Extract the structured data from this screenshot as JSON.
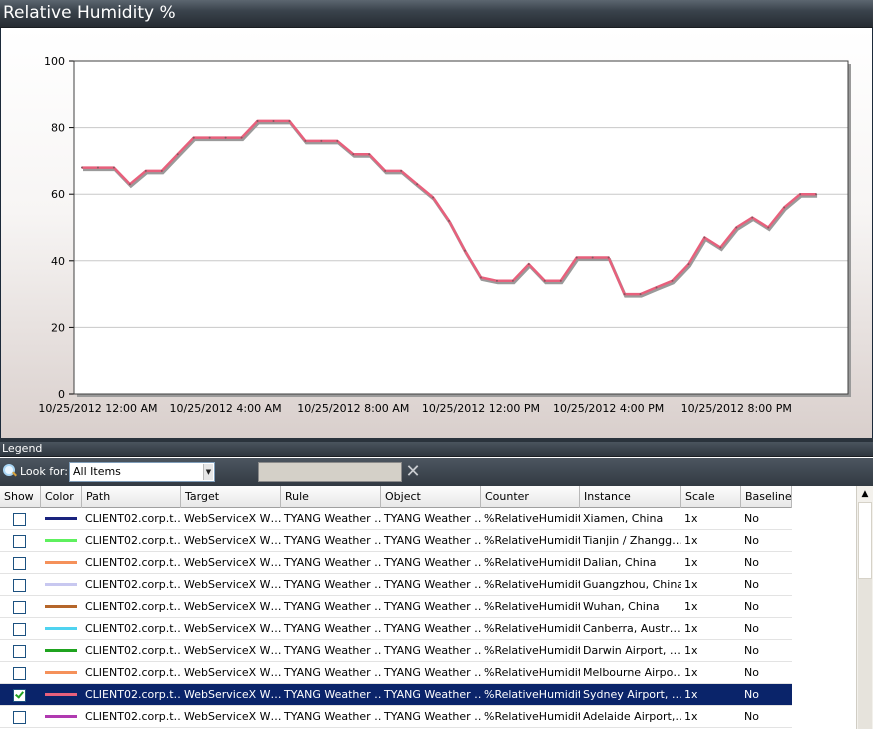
{
  "window": {
    "title": "Relative Humidity %"
  },
  "legend": {
    "title": "Legend",
    "look_for_label": "Look for:",
    "look_for_value": "All Items",
    "columns": [
      "Show",
      "Color",
      "Path",
      "Target",
      "Rule",
      "Object",
      "Counter",
      "Instance",
      "Scale",
      "Baseline"
    ],
    "rows": [
      {
        "show": false,
        "color": "#1a237e",
        "path": "CLIENT02.corp.t…",
        "target": "WebServiceX W…",
        "rule": "TYANG Weather …",
        "object": "TYANG Weather …",
        "counter": "%RelativeHumidity",
        "instance": "Xiamen, China",
        "scale": "1x",
        "baseline": "No"
      },
      {
        "show": false,
        "color": "#5ef05e",
        "path": "CLIENT02.corp.t…",
        "target": "WebServiceX W…",
        "rule": "TYANG Weather …",
        "object": "TYANG Weather …",
        "counter": "%RelativeHumidity",
        "instance": "Tianjin / Zhangg…",
        "scale": "1x",
        "baseline": "No"
      },
      {
        "show": false,
        "color": "#f5915a",
        "path": "CLIENT02.corp.t…",
        "target": "WebServiceX W…",
        "rule": "TYANG Weather …",
        "object": "TYANG Weather …",
        "counter": "%RelativeHumidity",
        "instance": "Dalian, China",
        "scale": "1x",
        "baseline": "No"
      },
      {
        "show": false,
        "color": "#c8c8f0",
        "path": "CLIENT02.corp.t…",
        "target": "WebServiceX W…",
        "rule": "TYANG Weather …",
        "object": "TYANG Weather …",
        "counter": "%RelativeHumidity",
        "instance": "Guangzhou, China",
        "scale": "1x",
        "baseline": "No"
      },
      {
        "show": false,
        "color": "#b5662a",
        "path": "CLIENT02.corp.t…",
        "target": "WebServiceX W…",
        "rule": "TYANG Weather …",
        "object": "TYANG Weather …",
        "counter": "%RelativeHumidity",
        "instance": "Wuhan, China",
        "scale": "1x",
        "baseline": "No"
      },
      {
        "show": false,
        "color": "#4fd3f0",
        "path": "CLIENT02.corp.t…",
        "target": "WebServiceX W…",
        "rule": "TYANG Weather …",
        "object": "TYANG Weather …",
        "counter": "%RelativeHumidity",
        "instance": "Canberra, Austr…",
        "scale": "1x",
        "baseline": "No"
      },
      {
        "show": false,
        "color": "#1fa31f",
        "path": "CLIENT02.corp.t…",
        "target": "WebServiceX W…",
        "rule": "TYANG Weather …",
        "object": "TYANG Weather …",
        "counter": "%RelativeHumidity",
        "instance": "Darwin Airport, …",
        "scale": "1x",
        "baseline": "No"
      },
      {
        "show": false,
        "color": "#f5915a",
        "path": "CLIENT02.corp.t…",
        "target": "WebServiceX W…",
        "rule": "TYANG Weather …",
        "object": "TYANG Weather …",
        "counter": "%RelativeHumidity",
        "instance": "Melbourne Airpo…",
        "scale": "1x",
        "baseline": "No"
      },
      {
        "show": true,
        "selected": true,
        "color": "#e8607c",
        "path": "CLIENT02.corp.t…",
        "target": "WebServiceX W…",
        "rule": "TYANG Weather …",
        "object": "TYANG Weather …",
        "counter": "%RelativeHumidity",
        "instance": "Sydney Airport, …",
        "scale": "1x",
        "baseline": "No"
      },
      {
        "show": false,
        "color": "#b03ab0",
        "path": "CLIENT02.corp.t…",
        "target": "WebServiceX W…",
        "rule": "TYANG Weather …",
        "object": "TYANG Weather …",
        "counter": "%RelativeHumidity",
        "instance": "Adelaide Airport,…",
        "scale": "1x",
        "baseline": "No"
      }
    ]
  },
  "chart_data": {
    "type": "line",
    "title": "Relative Humidity %",
    "xlabel": "",
    "ylabel": "",
    "ylim": [
      0,
      100
    ],
    "yticks": [
      0,
      20,
      40,
      60,
      80,
      100
    ],
    "xlim_hours": [
      -0.75,
      23.5
    ],
    "xtick_labels": [
      "10/25/2012 12:00 AM",
      "10/25/2012 4:00 AM",
      "10/25/2012 8:00 AM",
      "10/25/2012 12:00 PM",
      "10/25/2012 4:00 PM",
      "10/25/2012 8:00 PM"
    ],
    "xtick_hours": [
      0,
      4,
      8,
      12,
      16,
      20
    ],
    "grid": true,
    "series": [
      {
        "color": "#e8607c",
        "x_hours": [
          -0.5,
          0,
          0.5,
          1,
          1.5,
          2,
          2.5,
          3,
          3.5,
          4,
          4.5,
          5,
          5.5,
          6,
          6.5,
          7,
          7.5,
          8,
          8.5,
          9,
          9.5,
          10,
          10.5,
          11,
          11.5,
          12,
          12.5,
          13,
          13.5,
          14,
          14.5,
          15,
          15.5,
          16,
          16.5,
          17,
          17.5,
          18,
          18.5,
          19,
          19.5,
          20,
          20.5,
          21,
          21.5,
          22,
          22.5
        ],
        "values": [
          68,
          68,
          68,
          63,
          67,
          67,
          72,
          77,
          77,
          77,
          77,
          82,
          82,
          82,
          76,
          76,
          76,
          72,
          72,
          67,
          67,
          63,
          59,
          52,
          43,
          35,
          34,
          34,
          39,
          34,
          34,
          41,
          41,
          41,
          30,
          30,
          32,
          34,
          39,
          47,
          44,
          50,
          53,
          50,
          56,
          60,
          60
        ]
      }
    ]
  }
}
